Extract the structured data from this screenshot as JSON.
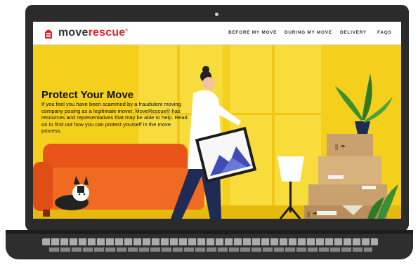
{
  "header": {
    "logo": {
      "part1": "move",
      "part2": "rescue",
      "mark": "®"
    },
    "nav": [
      {
        "label": "BEFORE MY MOVE"
      },
      {
        "label": "DURING MY MOVE"
      },
      {
        "label": "DELIVERY"
      },
      {
        "label": "FAQS"
      }
    ]
  },
  "hero": {
    "title": "Protect Your Move",
    "body": "If you feel you have been scammed by a fraudulent moving company posing as a legitimate mover, MoveRescue® has resources and representatives that may be able to help. Read on to find out how you can protect yourself in the move process."
  },
  "colors": {
    "brand_red": "#e1242b",
    "wall_yellow": "#f4cf1c",
    "sofa_orange": "#e8541a",
    "box_brown": "#c9a16e",
    "plant_green": "#3a8f2e"
  },
  "icons": [
    "moverescue-logo-icon",
    "dog-illustration",
    "person-carrying-painting-illustration",
    "floor-lamp-illustration",
    "moving-boxes-illustration",
    "potted-plant-illustration"
  ]
}
